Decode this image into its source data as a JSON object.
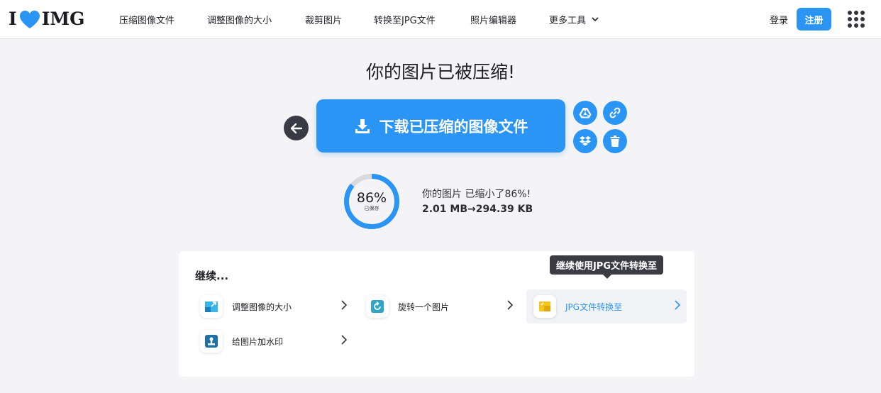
{
  "logo": {
    "left": "I",
    "right": "IMG"
  },
  "nav": {
    "items": [
      "压缩图像文件",
      "调整图像的大小",
      "裁剪图片",
      "转换至JPG文件",
      "照片编辑器",
      "更多工具"
    ],
    "login": "登录",
    "register": "注册"
  },
  "main": {
    "title": "你的图片已被压缩!",
    "download_label": "下载已压缩的图像文件",
    "percent": "86%",
    "percent_value": 86,
    "percent_sub": "已保存",
    "saved_text": "你的图片 已缩小了86%!",
    "size_text": "2.01 MB→294.39 KB"
  },
  "continue": {
    "title": "继续...",
    "tooltip": "继续使用JPG文件转换至",
    "tools": [
      "调整图像的大小",
      "旋转一个图片",
      "JPG文件转换至",
      "给图片加水印"
    ]
  },
  "colors": {
    "accent": "#2b95f5",
    "logo_heart": "#2b95f5",
    "dark_button": "#3a3a44"
  },
  "icons": [
    "heart-icon",
    "chevron-down-icon",
    "apps-grid-icon",
    "arrow-left-icon",
    "download-icon",
    "google-drive-icon",
    "link-icon",
    "dropbox-icon",
    "trash-icon",
    "resize-icon",
    "rotate-icon",
    "convert-jpg-icon",
    "watermark-icon",
    "chevron-right-icon"
  ]
}
